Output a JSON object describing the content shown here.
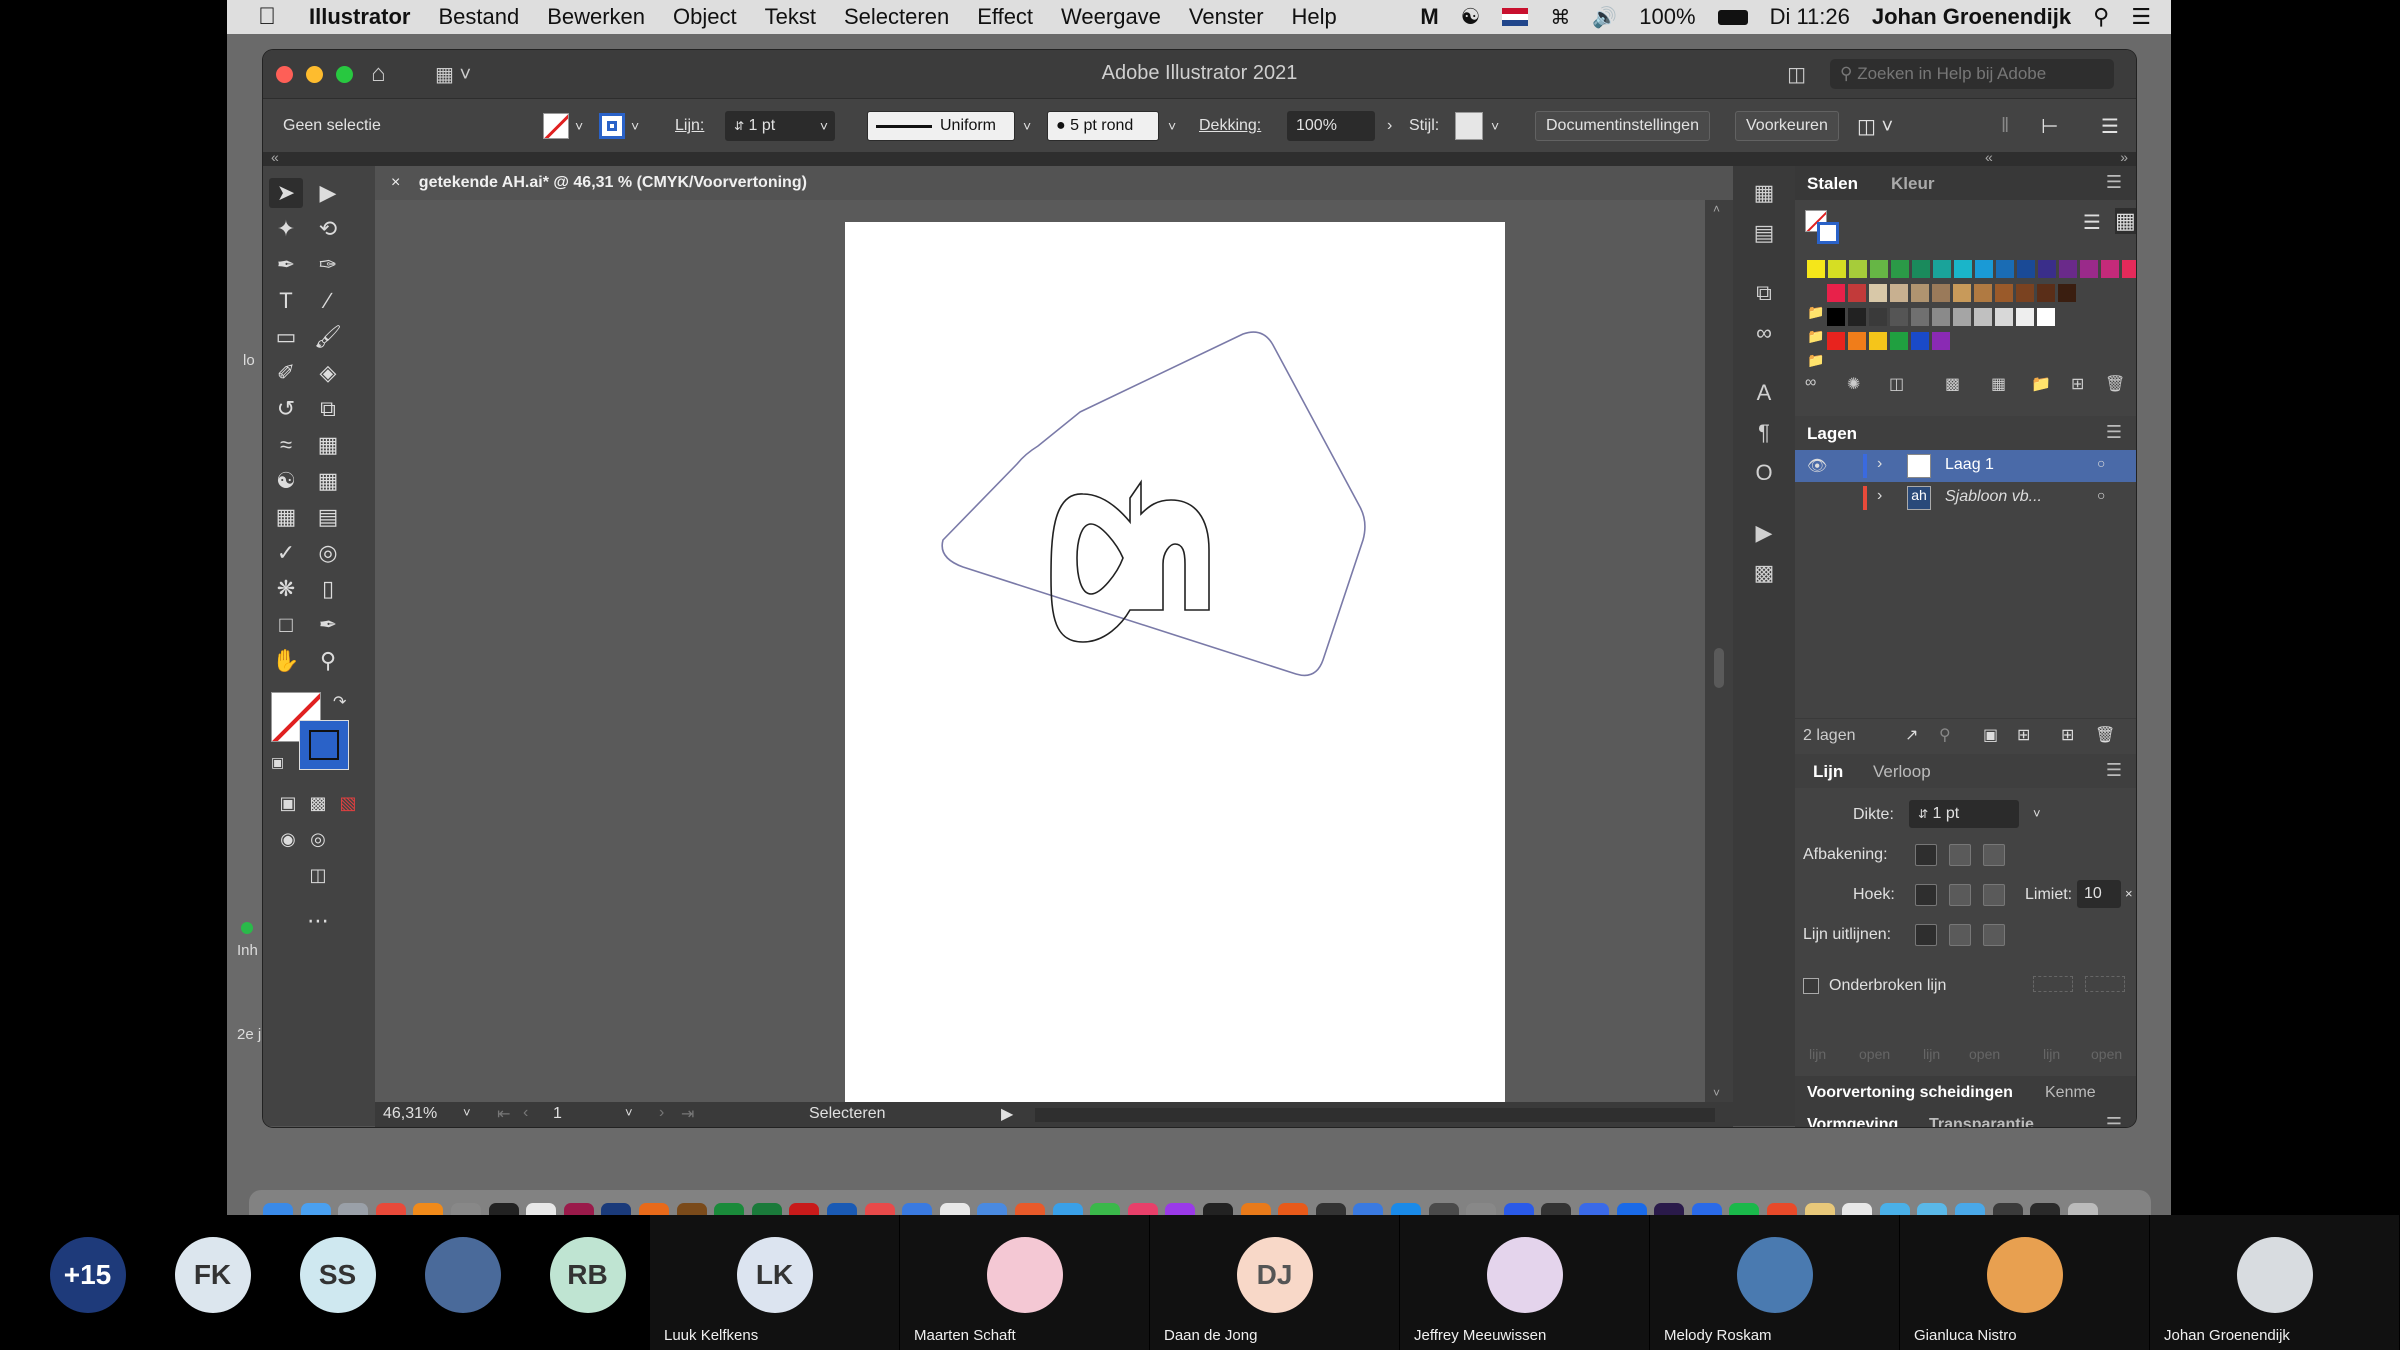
{
  "menubar": {
    "app": "Illustrator",
    "items": [
      "Bestand",
      "Bewerken",
      "Object",
      "Tekst",
      "Selecteren",
      "Effect",
      "Weergave",
      "Venster",
      "Help"
    ],
    "battery": "100%",
    "clock": "Di 11:26",
    "user": "Johan Groenendijk"
  },
  "window": {
    "title": "Adobe Illustrator 2021",
    "help_search_placeholder": "Zoeken in Help bij Adobe"
  },
  "control_bar": {
    "selection": "Geen selectie",
    "stroke_label": "Lijn:",
    "stroke_weight": "1 pt",
    "stroke_profile": "Uniform",
    "brush": "5 pt rond",
    "opacity_label": "Dekking:",
    "opacity": "100%",
    "style_label": "Stijl:",
    "doc_settings": "Documentinstellingen",
    "preferences": "Voorkeuren"
  },
  "document": {
    "tab_label": "getekende AH.ai* @ 46,31 % (CMYK/Voorvertoning)",
    "close_glyph": "×"
  },
  "status_bar": {
    "zoom": "46,31%",
    "artboard": "1",
    "mode": "Selecteren"
  },
  "swatches_panel": {
    "tabs": [
      "Stalen",
      "Kleur"
    ],
    "rows": [
      [
        "#f5e61a",
        "#d6de23",
        "#a6cc3a",
        "#66b645",
        "#2b9a47",
        "#1a8a5c",
        "#1aa39a",
        "#1ab5c9",
        "#1a9ad6",
        "#1a6cb4",
        "#1a4a96",
        "#3a2e8a",
        "#6a2a8a",
        "#9a2a8a",
        "#c42a7a",
        "#e42a5a"
      ],
      [
        "#e8214a",
        "#c23a3a",
        "#d8c8a8",
        "#c8b090",
        "#b09470",
        "#9a7a5a",
        "#c89a5a",
        "#b07a42",
        "#9a5a2a",
        "#7a4220",
        "#5a2e18",
        "#3a1e10"
      ],
      [
        "#000000",
        "#222222",
        "#3a3a3a",
        "#555555",
        "#707070",
        "#8a8a8a",
        "#a5a5a5",
        "#c0c0c0",
        "#d8d8d8",
        "#eeeeee",
        "#ffffff"
      ],
      [
        "#e8231e",
        "#f07d1a",
        "#f5c51a",
        "#20a040",
        "#1a4ac8",
        "#8a2ab4"
      ]
    ]
  },
  "layers_panel": {
    "title": "Lagen",
    "layers": [
      {
        "name": "Laag 1",
        "color": "#3a6ae0"
      },
      {
        "name": "Sjabloon vb...",
        "color": "#e84a3a"
      }
    ],
    "count": "2 lagen"
  },
  "stroke_panel": {
    "tabs": [
      "Lijn",
      "Verloop"
    ],
    "weight_label": "Dikte:",
    "weight": "1 pt",
    "cap_label": "Afbakening:",
    "corner_label": "Hoek:",
    "limit_label": "Limiet:",
    "limit": "10",
    "align_label": "Lijn uitlijnen:",
    "dashed_label": "Onderbroken lijn",
    "dash_fields": [
      "lijn",
      "open",
      "lijn",
      "open",
      "lijn",
      "open"
    ]
  },
  "bottom_panels": {
    "row1": [
      "Voorvertoning scheidingen",
      "Kenme"
    ],
    "row2": [
      "Vormgeving",
      "Transparantie"
    ]
  },
  "side_labels": [
    "lo",
    "Inh",
    "2e j"
  ],
  "participants": [
    {
      "initials": "+15",
      "name": "",
      "color": "#1e3a7a",
      "text_color": "#ffffff"
    },
    {
      "initials": "FK",
      "name": "",
      "color": "#dce6ee",
      "text_color": "#333333"
    },
    {
      "initials": "SS",
      "name": "",
      "color": "#cfe8f0",
      "text_color": "#333333"
    },
    {
      "initials": "",
      "name": "",
      "color": "#4a6a9a",
      "text_color": "#ffffff"
    },
    {
      "initials": "RB",
      "name": "",
      "color": "#bfe4d2",
      "text_color": "#333333"
    },
    {
      "initials": "LK",
      "name": "Luuk Kelfkens",
      "color": "#dce4f0",
      "text_color": "#333333"
    },
    {
      "initials": "",
      "name": "Maarten Schaft",
      "color": "#f4c8d4",
      "text_color": "#333333"
    },
    {
      "initials": "DJ",
      "name": "Daan de Jong",
      "color": "#f8d8c8",
      "text_color": "#555555"
    },
    {
      "initials": "",
      "name": "Jeffrey Meeuwissen",
      "color": "#e4d4ec",
      "text_color": "#333333"
    },
    {
      "initials": "",
      "name": "Melody Roskam",
      "color": "#4a7ab0",
      "text_color": "#ffffff"
    },
    {
      "initials": "",
      "name": "Gianluca Nistro",
      "color": "#e8a050",
      "text_color": "#ffffff"
    },
    {
      "initials": "",
      "name": "Johan Groenendijk",
      "color": "#d8dce0",
      "text_color": "#333333"
    }
  ],
  "dock_icon_colors": [
    "#3a8ae8",
    "#4aa0f0",
    "#9aa0a8",
    "#e84a3a",
    "#f08a1a",
    "#888888",
    "#222222",
    "#e8e8e8",
    "#9a1a4a",
    "#1a3a7a",
    "#e86a1a",
    "#7a4a1a",
    "#1a8a3a",
    "#1a7a3a",
    "#c81a1a",
    "#1a5ab4",
    "#e84a4a",
    "#3a7ae0",
    "#e8e8e8",
    "#4a8ae0",
    "#e85a2a",
    "#3aa0e8",
    "#3ab84a",
    "#e8406a",
    "#9a3ae8",
    "#222222",
    "#e87a1a",
    "#e85a1a",
    "#333333",
    "#3a7ae0",
    "#1a8ae8",
    "#4a4a4a",
    "#888888",
    "#2a5ae8",
    "#333333",
    "#3a6ae8",
    "#1a6ae8",
    "#2a1a4a",
    "#2a6ae8",
    "#1ab84a",
    "#e84a2a",
    "#e8c87a",
    "#e8e8e8",
    "#4ab0e8",
    "#5ab8e8",
    "#4aa8e8",
    "#3a3a3a",
    "#2a2a2a",
    "#bbbbbb"
  ]
}
